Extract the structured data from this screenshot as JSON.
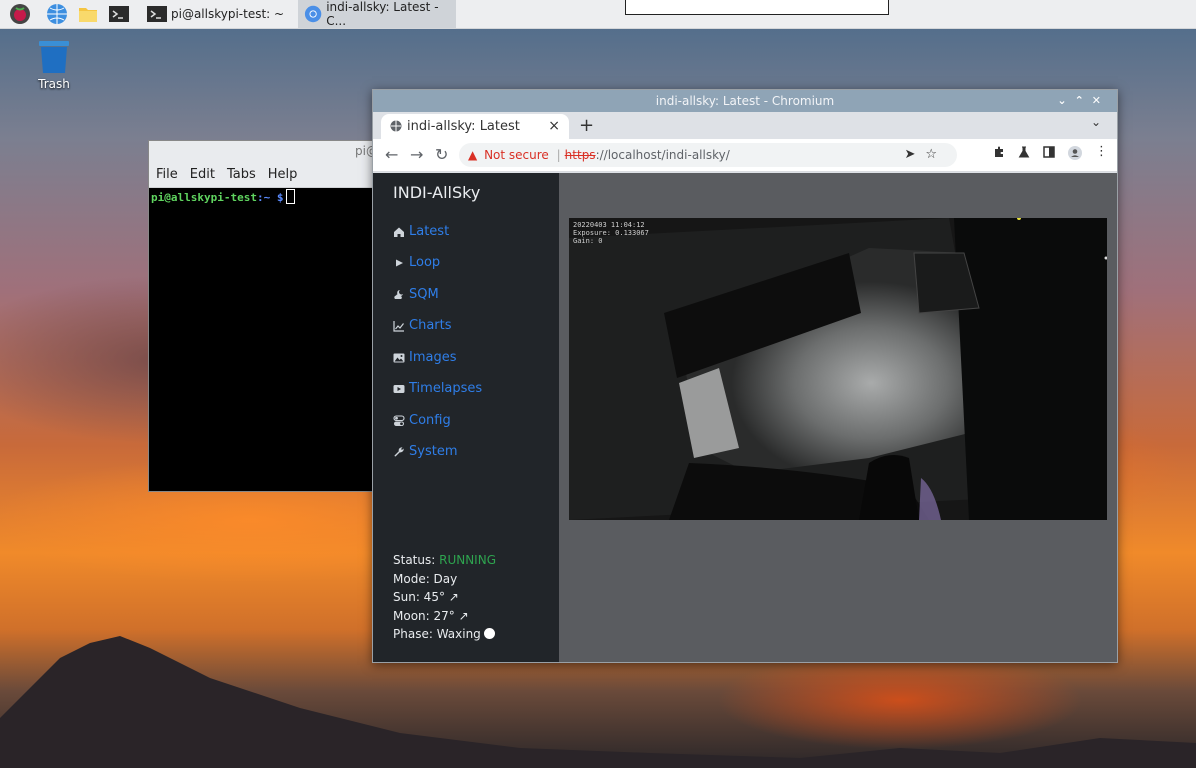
{
  "taskbar": {
    "tasks": [
      {
        "label": "pi@allskypi-test: ~"
      },
      {
        "label": "indi-allsky: Latest - C..."
      }
    ]
  },
  "desktop": {
    "trash_label": "Trash"
  },
  "terminal": {
    "title": "pi@allskypi-test: ~",
    "menu": [
      "File",
      "Edit",
      "Tabs",
      "Help"
    ],
    "prompt_user": "pi@allskypi-test",
    "prompt_path": ":~ $"
  },
  "browser": {
    "window_title": "indi-allsky: Latest - Chromium",
    "tab_title": "indi-allsky: Latest",
    "tab_close": "×",
    "new_tab": "+",
    "not_secure": "Not secure",
    "url_scheme": "https",
    "url_rest": "://localhost/indi-allsky/"
  },
  "app": {
    "brand": "INDI-AllSky",
    "nav": [
      {
        "label": "Latest",
        "icon": "home-icon"
      },
      {
        "label": "Loop",
        "icon": "play-icon"
      },
      {
        "label": "SQM",
        "icon": "cloud-moon-icon"
      },
      {
        "label": "Charts",
        "icon": "chart-line-icon"
      },
      {
        "label": "Images",
        "icon": "image-icon"
      },
      {
        "label": "Timelapses",
        "icon": "video-icon"
      },
      {
        "label": "Config",
        "icon": "toggles-icon"
      },
      {
        "label": "System",
        "icon": "wrench-icon"
      }
    ],
    "status": {
      "status_label": "Status:",
      "status_value": "RUNNING",
      "mode": "Mode: Day",
      "sun": "Sun: 45° ↗",
      "moon": "Moon: 27° ↗",
      "phase": "Phase: Waxing"
    },
    "image_overlay": {
      "timestamp": "20220403 11:04:12",
      "exposure": "Exposure: 0.133067",
      "gain": "Gain: 0"
    },
    "colors": {
      "sidebar_bg": "#212529",
      "link": "#2f7ee8",
      "running": "#2ea44f"
    }
  }
}
